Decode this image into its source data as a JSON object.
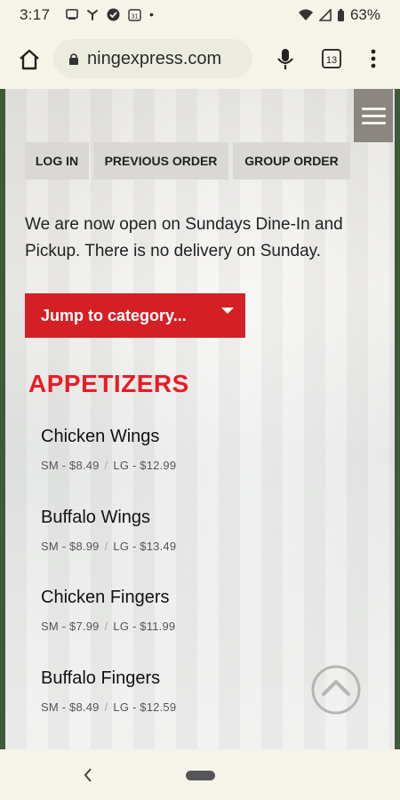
{
  "status_bar": {
    "time": "3:17",
    "battery": "63%"
  },
  "browser": {
    "url": "ningexpress.com",
    "tab_count": "13"
  },
  "nav": {
    "login": "LOG IN",
    "previous_order": "PREVIOUS ORDER",
    "group_order": "GROUP ORDER"
  },
  "notice": "We are now open on Sundays Dine-In and Pickup. There is no delivery on Sunday.",
  "jump": {
    "label": "Jump to category..."
  },
  "menu": {
    "section_title": "APPETIZERS",
    "items": [
      {
        "name": "Chicken Wings",
        "sm": "SM - $8.49",
        "lg": "LG - $12.99"
      },
      {
        "name": "Buffalo Wings",
        "sm": "SM - $8.99",
        "lg": "LG - $13.49"
      },
      {
        "name": "Chicken Fingers",
        "sm": "SM - $7.99",
        "lg": "LG - $11.99"
      },
      {
        "name": "Buffalo Fingers",
        "sm": "SM - $8.49",
        "lg": "LG - $12.59"
      }
    ],
    "separator": "/"
  },
  "colors": {
    "accent_red": "#d42025",
    "title_red": "#ea1c24"
  }
}
